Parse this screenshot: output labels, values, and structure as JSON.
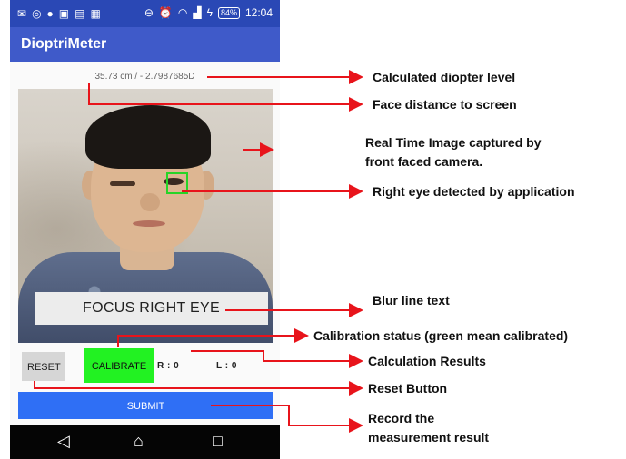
{
  "status_bar": {
    "battery": "84%",
    "time": "12:04"
  },
  "app_title": "DioptriMeter",
  "readout": "35.73 cm / - 2.7987685D",
  "camera": {
    "blur_text": "FOCUS RIGHT EYE"
  },
  "controls": {
    "reset_label": "RESET",
    "calibrate_label": "CALIBRATE",
    "result_r": "R : 0",
    "result_l": "L : 0",
    "submit_label": "SUBMIT"
  },
  "colors": {
    "app_bar": "#3f5ac9",
    "status_bar": "#2a48b5",
    "calibrate_ok": "#22f222",
    "submit": "#2f6ff5",
    "eye_box": "#27d427",
    "arrow": "#e8141b"
  },
  "annotations": {
    "diopter": "Calculated diopter level",
    "distance": "Face distance to screen",
    "realtime_1": "Real Time Image captured by",
    "realtime_2": "front faced camera.",
    "eye": "Right eye detected by application",
    "blur": "Blur line text",
    "calibration": "Calibration status (green mean calibrated)",
    "results": "Calculation Results",
    "reset": "Reset Button",
    "record_1": "Record the",
    "record_2": "measurement result"
  }
}
